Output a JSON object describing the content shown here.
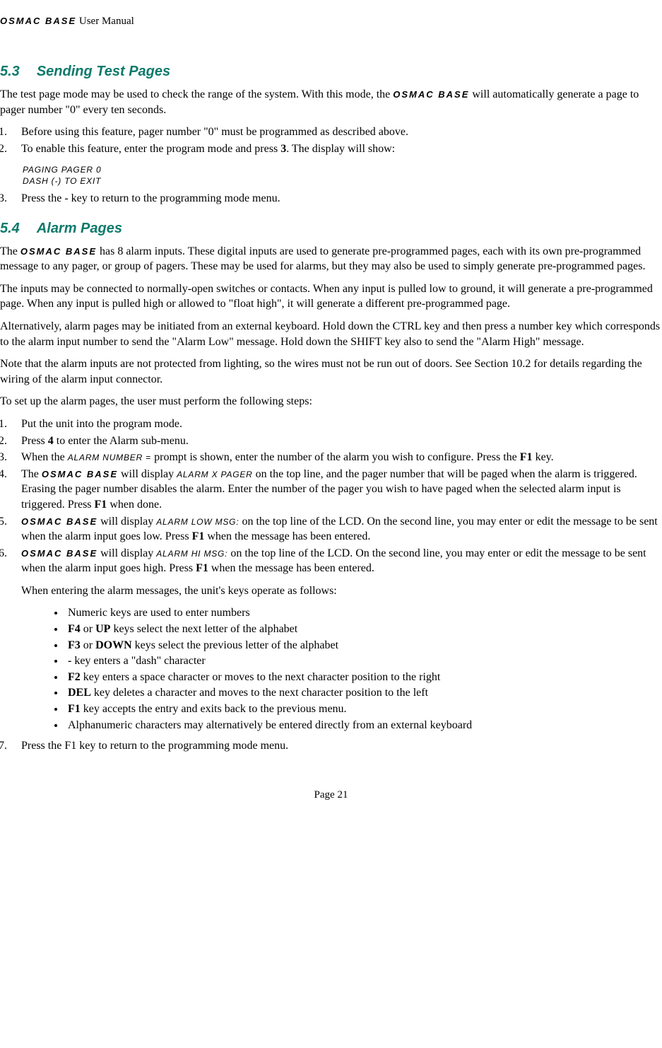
{
  "header": {
    "product": "OSMAC BASE",
    "tail": " User Manual"
  },
  "section53": {
    "num": "5.3",
    "title": "Sending Test Pages",
    "intro_pre": "The test page mode may be used to check the range of the system.  With this mode, the ",
    "intro_product": "OSMAC BASE",
    "intro_post": " will automatically generate a page to pager number \"0\" every ten seconds.",
    "li1": "Before using this feature, pager number \"0\" must be programmed as described above.",
    "li2_pre": "To enable this feature, enter the program mode and press ",
    "li2_key": "3",
    "li2_post": ".  The display will show:",
    "displayLine1": "PAGING PAGER 0",
    "displayLine2": "DASH (-) TO EXIT",
    "li3": "Press the - key to return to the programming mode menu."
  },
  "section54": {
    "num": "5.4",
    "title": "Alarm Pages",
    "p1_pre": "The ",
    "p1_product": "OSMAC BASE",
    "p1_post": " has 8 alarm inputs.  These digital inputs are used to generate pre-programmed pages, each with its own pre-programmed message to any pager, or group of pagers. These may be used for alarms, but they may also be used to simply generate pre-programmed pages.",
    "p2": "The inputs may be connected to normally-open switches or contacts.  When any input is pulled low to ground, it will generate a pre-programmed page. When any input is pulled high or allowed to \"float high\", it will generate a different pre-programmed page.",
    "p3": "Alternatively, alarm pages may be initiated from an external keyboard.  Hold down the CTRL key and then press a number key which corresponds to the alarm input number to send the \"Alarm Low\" message.  Hold down the SHIFT key also to send the \"Alarm High\" message.",
    "p4": "Note that the alarm inputs are not protected from lighting, so the wires must not be run out of doors.  See Section 10.2 for details regarding the wiring of the alarm input connector.",
    "p5": "To set up the alarm pages, the user must perform the following steps:",
    "ol2": {
      "li1": "Put the unit into the program mode.",
      "li2_pre": "Press ",
      "li2_key": "4",
      "li2_post": " to enter the Alarm sub-menu.",
      "li3_pre": "When the ",
      "li3_lcd": "ALARM NUMBER = ",
      "li3_mid": " prompt is shown, enter the number of the alarm you wish to configure. Press the ",
      "li3_key": "F1",
      "li3_post": " key.",
      "li4_pre": "The ",
      "li4_product": "OSMAC BASE",
      "li4_mid1": " will display ",
      "li4_lcd": "ALARM X PAGER",
      "li4_mid2": " on the top line, and the pager number that will be paged when the alarm is triggered.  Erasing the pager number disables the alarm.  Enter the number of the pager you wish to have paged when the selected alarm input is triggered. Press ",
      "li4_key": "F1",
      "li4_post": " when done.",
      "li5_product": "OSMAC BASE",
      "li5_mid1": " will display ",
      "li5_lcd": "ALARM LOW MSG:",
      "li5_mid2": " on the top line of the LCD.  On the second line, you may enter or edit the message to be sent when the alarm input goes low. Press ",
      "li5_key": "F1",
      "li5_post": " when the message has been entered.",
      "li6_product": "OSMAC BASE",
      "li6_mid1": " will display ",
      "li6_lcd": "ALARM HI MSG:",
      "li6_mid2": " on the top line of the LCD.  On the second line, you may enter or edit the message to be sent when the alarm input goes high. Press ",
      "li6_key": "F1",
      "li6_post": " when the message has been entered.",
      "keysIntro": "When entering the alarm messages, the unit's keys operate as follows:",
      "bullets": {
        "b1": "Numeric keys are used to enter numbers",
        "b2_k1": "F4",
        "b2_mid": " or ",
        "b2_k2": "UP",
        "b2_post": " keys select the next letter of the alphabet",
        "b3_k1": "F3",
        "b3_mid": " or ",
        "b3_k2": "DOWN",
        "b3_post": " keys select the previous letter of the alphabet",
        "b4_k": "-",
        "b4_post": " key enters a \"dash\" character",
        "b5_k": "F2",
        "b5_post": " key enters a space character or moves to the next character position to the right",
        "b6_k": "DEL",
        "b6_post": " key deletes a character and moves to the next character position to the left",
        "b7_k": "F1",
        "b7_post": " key accepts the entry and exits back to the previous menu.",
        "b8": "Alphanumeric characters may alternatively be entered directly from an external keyboard"
      },
      "li7": "Press the F1 key to return to the programming mode menu."
    }
  },
  "footer": {
    "page": "Page 21"
  }
}
